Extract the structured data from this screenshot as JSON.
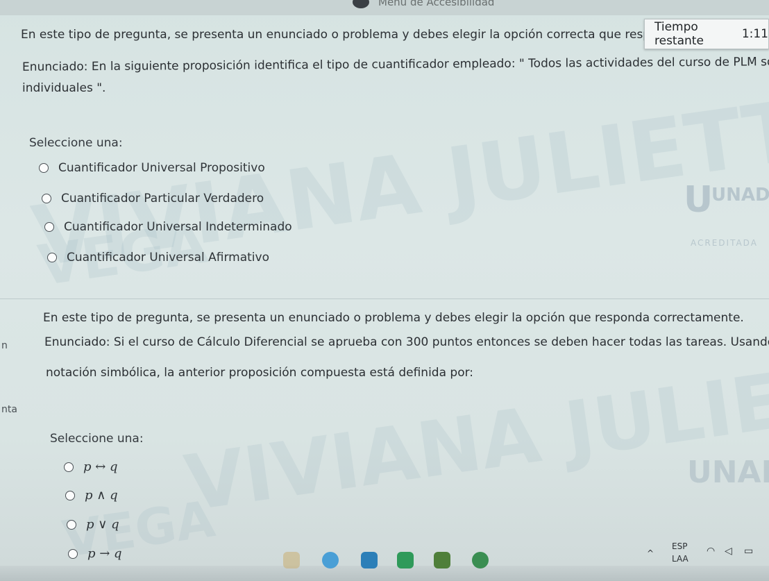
{
  "topbar": {
    "menu_label": "Menú de Accesibilidad"
  },
  "timer": {
    "label": "Tiempo restante",
    "value": "1:11"
  },
  "watermark": {
    "line1": "VIVIANA JULIETTE MEDINA",
    "line2": "VEGA"
  },
  "logo": {
    "name": "UNAD",
    "accreditation": "ACREDITADA"
  },
  "question1": {
    "instruction": "En este tipo de pregunta, se presenta un enunciado o problema y debes elegir la opción correcta que resp",
    "statement_line1": "Enunciado: En la siguiente proposición identifica el tipo de cuantificador empleado: \" Todos las actividades del curso de PLM son",
    "statement_line2": "individuales \".",
    "select_label": "Seleccione una:",
    "options": [
      "Cuantificador Universal Propositivo",
      "Cuantificador Particular Verdadero",
      "Cuantificador Universal Indeterminado",
      "Cuantificador Universal Afirmativo"
    ]
  },
  "question2": {
    "instruction": "En este tipo de pregunta, se presenta un enunciado o problema y debes elegir la opción que responda correctamente.",
    "statement_line1": "Enunciado: Si el curso de Cálculo Diferencial se aprueba con 300 puntos entonces se deben hacer todas las tareas. Usando la",
    "statement_line2": "notación simbólica, la anterior proposición compuesta está definida por:",
    "select_label": "Seleccione una:",
    "options": [
      "p ↔ q",
      "p ∧ q",
      "p ∨ q",
      "p → q"
    ]
  },
  "sidebar_fragments": {
    "frag1": "n",
    "frag2": "nta"
  },
  "tray": {
    "lang1": "ESP",
    "lang2": "LAA",
    "chevron": "^"
  }
}
